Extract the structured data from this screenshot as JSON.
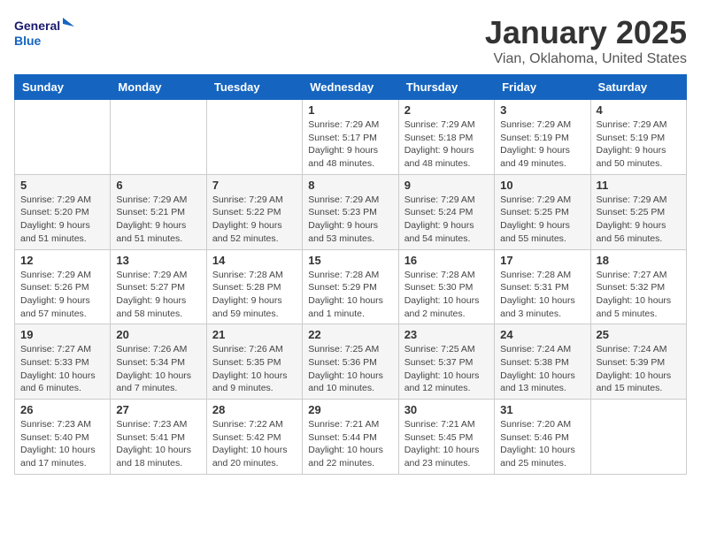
{
  "header": {
    "logo_line1": "General",
    "logo_line2": "Blue",
    "title": "January 2025",
    "subtitle": "Vian, Oklahoma, United States"
  },
  "weekdays": [
    "Sunday",
    "Monday",
    "Tuesday",
    "Wednesday",
    "Thursday",
    "Friday",
    "Saturday"
  ],
  "weeks": [
    [
      {
        "day": "",
        "info": ""
      },
      {
        "day": "",
        "info": ""
      },
      {
        "day": "",
        "info": ""
      },
      {
        "day": "1",
        "info": "Sunrise: 7:29 AM\nSunset: 5:17 PM\nDaylight: 9 hours\nand 48 minutes."
      },
      {
        "day": "2",
        "info": "Sunrise: 7:29 AM\nSunset: 5:18 PM\nDaylight: 9 hours\nand 48 minutes."
      },
      {
        "day": "3",
        "info": "Sunrise: 7:29 AM\nSunset: 5:19 PM\nDaylight: 9 hours\nand 49 minutes."
      },
      {
        "day": "4",
        "info": "Sunrise: 7:29 AM\nSunset: 5:19 PM\nDaylight: 9 hours\nand 50 minutes."
      }
    ],
    [
      {
        "day": "5",
        "info": "Sunrise: 7:29 AM\nSunset: 5:20 PM\nDaylight: 9 hours\nand 51 minutes."
      },
      {
        "day": "6",
        "info": "Sunrise: 7:29 AM\nSunset: 5:21 PM\nDaylight: 9 hours\nand 51 minutes."
      },
      {
        "day": "7",
        "info": "Sunrise: 7:29 AM\nSunset: 5:22 PM\nDaylight: 9 hours\nand 52 minutes."
      },
      {
        "day": "8",
        "info": "Sunrise: 7:29 AM\nSunset: 5:23 PM\nDaylight: 9 hours\nand 53 minutes."
      },
      {
        "day": "9",
        "info": "Sunrise: 7:29 AM\nSunset: 5:24 PM\nDaylight: 9 hours\nand 54 minutes."
      },
      {
        "day": "10",
        "info": "Sunrise: 7:29 AM\nSunset: 5:25 PM\nDaylight: 9 hours\nand 55 minutes."
      },
      {
        "day": "11",
        "info": "Sunrise: 7:29 AM\nSunset: 5:25 PM\nDaylight: 9 hours\nand 56 minutes."
      }
    ],
    [
      {
        "day": "12",
        "info": "Sunrise: 7:29 AM\nSunset: 5:26 PM\nDaylight: 9 hours\nand 57 minutes."
      },
      {
        "day": "13",
        "info": "Sunrise: 7:29 AM\nSunset: 5:27 PM\nDaylight: 9 hours\nand 58 minutes."
      },
      {
        "day": "14",
        "info": "Sunrise: 7:28 AM\nSunset: 5:28 PM\nDaylight: 9 hours\nand 59 minutes."
      },
      {
        "day": "15",
        "info": "Sunrise: 7:28 AM\nSunset: 5:29 PM\nDaylight: 10 hours\nand 1 minute."
      },
      {
        "day": "16",
        "info": "Sunrise: 7:28 AM\nSunset: 5:30 PM\nDaylight: 10 hours\nand 2 minutes."
      },
      {
        "day": "17",
        "info": "Sunrise: 7:28 AM\nSunset: 5:31 PM\nDaylight: 10 hours\nand 3 minutes."
      },
      {
        "day": "18",
        "info": "Sunrise: 7:27 AM\nSunset: 5:32 PM\nDaylight: 10 hours\nand 5 minutes."
      }
    ],
    [
      {
        "day": "19",
        "info": "Sunrise: 7:27 AM\nSunset: 5:33 PM\nDaylight: 10 hours\nand 6 minutes."
      },
      {
        "day": "20",
        "info": "Sunrise: 7:26 AM\nSunset: 5:34 PM\nDaylight: 10 hours\nand 7 minutes."
      },
      {
        "day": "21",
        "info": "Sunrise: 7:26 AM\nSunset: 5:35 PM\nDaylight: 10 hours\nand 9 minutes."
      },
      {
        "day": "22",
        "info": "Sunrise: 7:25 AM\nSunset: 5:36 PM\nDaylight: 10 hours\nand 10 minutes."
      },
      {
        "day": "23",
        "info": "Sunrise: 7:25 AM\nSunset: 5:37 PM\nDaylight: 10 hours\nand 12 minutes."
      },
      {
        "day": "24",
        "info": "Sunrise: 7:24 AM\nSunset: 5:38 PM\nDaylight: 10 hours\nand 13 minutes."
      },
      {
        "day": "25",
        "info": "Sunrise: 7:24 AM\nSunset: 5:39 PM\nDaylight: 10 hours\nand 15 minutes."
      }
    ],
    [
      {
        "day": "26",
        "info": "Sunrise: 7:23 AM\nSunset: 5:40 PM\nDaylight: 10 hours\nand 17 minutes."
      },
      {
        "day": "27",
        "info": "Sunrise: 7:23 AM\nSunset: 5:41 PM\nDaylight: 10 hours\nand 18 minutes."
      },
      {
        "day": "28",
        "info": "Sunrise: 7:22 AM\nSunset: 5:42 PM\nDaylight: 10 hours\nand 20 minutes."
      },
      {
        "day": "29",
        "info": "Sunrise: 7:21 AM\nSunset: 5:44 PM\nDaylight: 10 hours\nand 22 minutes."
      },
      {
        "day": "30",
        "info": "Sunrise: 7:21 AM\nSunset: 5:45 PM\nDaylight: 10 hours\nand 23 minutes."
      },
      {
        "day": "31",
        "info": "Sunrise: 7:20 AM\nSunset: 5:46 PM\nDaylight: 10 hours\nand 25 minutes."
      },
      {
        "day": "",
        "info": ""
      }
    ]
  ]
}
